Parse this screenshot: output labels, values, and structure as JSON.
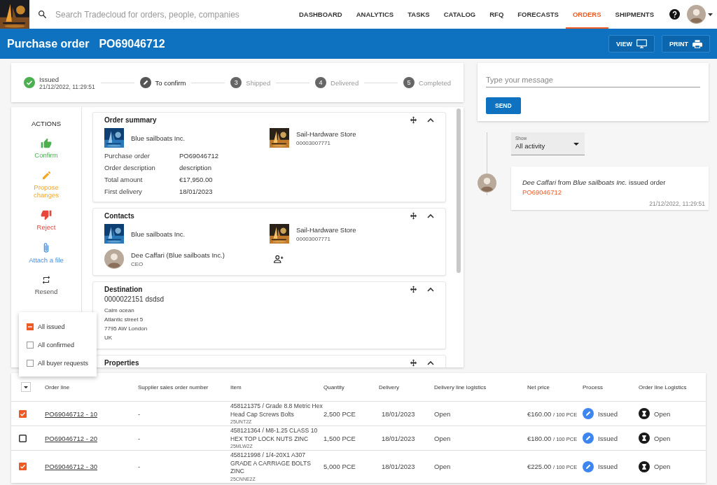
{
  "nav": {
    "search_placeholder": "Search Tradecloud for orders, people, companies",
    "items": [
      {
        "label": "DASHBOARD",
        "selected": false
      },
      {
        "label": "ANALYTICS",
        "selected": false
      },
      {
        "label": "TASKS",
        "selected": false
      },
      {
        "label": "CATALOG",
        "selected": false
      },
      {
        "label": "RFQ",
        "selected": false
      },
      {
        "label": "FORECASTS",
        "selected": false
      },
      {
        "label": "ORDERS",
        "selected": true
      },
      {
        "label": "SHIPMENTS",
        "selected": false
      }
    ]
  },
  "page_header": {
    "title": "Purchase order",
    "order_number": "PO69046712",
    "buttons": [
      {
        "label": "VIEW",
        "kind": "view"
      },
      {
        "label": "PRINT",
        "kind": "print"
      }
    ]
  },
  "stepper": [
    {
      "label": "Issued",
      "timestamp": "21/12/2022, 11:29:51",
      "done": true,
      "current": false
    },
    {
      "label": "To confirm",
      "done": false,
      "current": true
    },
    {
      "label": "Shipped",
      "number": "3",
      "done": false,
      "current": false
    },
    {
      "label": "Delivered",
      "number": "4",
      "done": false,
      "current": false
    },
    {
      "label": "Completed",
      "number": "5",
      "done": false,
      "current": false
    }
  ],
  "actions": {
    "title": "ACTIONS",
    "items": [
      {
        "label": "Confirm",
        "kind": "confirm"
      },
      {
        "label": "Propose changes",
        "kind": "propose"
      },
      {
        "label": "Reject",
        "kind": "reject"
      },
      {
        "label": "Attach a file",
        "kind": "attach"
      },
      {
        "label": "Resend",
        "kind": "resend"
      }
    ]
  },
  "sections": [
    {
      "kind": "summary",
      "title": "Order summary",
      "buyer": {
        "name": "Blue sailboats Inc."
      },
      "supplier": {
        "name": "Sail-Hardware Store",
        "number": "00003007771"
      },
      "fields": [
        {
          "label": "Purchase order",
          "value": "PO69046712"
        },
        {
          "label": "Order description",
          "value": "description"
        },
        {
          "label": "Total amount",
          "value": "€17,950.00"
        },
        {
          "label": "First delivery",
          "value": "18/01/2023"
        }
      ]
    },
    {
      "kind": "contacts",
      "title": "Contacts",
      "buyer": {
        "name": "Blue sailboats Inc."
      },
      "supplier": {
        "name": "Sail-Hardware Store",
        "number": "00003007771"
      },
      "person": {
        "name": "Dee Caffari (Blue sailboats Inc.)",
        "role": "CEO"
      }
    },
    {
      "kind": "address",
      "title": "Destination",
      "heading": "0000022151 dsdsd",
      "lines": [
        "Calm ocean",
        "Atlantic street 5",
        "7795 AW London",
        "UK"
      ]
    },
    {
      "kind": "empty",
      "title": "Properties"
    }
  ],
  "filter_menu": [
    {
      "label": "All issued",
      "indeterminate": true
    },
    {
      "label": "All confirmed",
      "indeterminate": false
    },
    {
      "label": "All buyer requests",
      "indeterminate": false
    }
  ],
  "message": {
    "placeholder": "Type your message",
    "send": "SEND"
  },
  "activity": {
    "filter_label": "Show",
    "filter_value": "All activity",
    "entries": [
      {
        "text": "*Dee Caffari* from *Blue sailboats Inc.* issued order",
        "link": "PO69046712",
        "time": "21/12/2022, 11:29:51"
      }
    ]
  },
  "table": {
    "columns": [
      "Order line",
      "Supplier sales order number",
      "Item",
      "Quantity",
      "Delivery",
      "Delivery line logistics",
      "Net price",
      "Process",
      "Order line Logistics"
    ],
    "rows": [
      {
        "checked": true,
        "order_line": "PO69046712 - 10",
        "supplier_order": "-",
        "item": "458121375 / Grade 8.8 Metric Hex Head Cap Screws Bolts",
        "item_code": "25UNT2Z",
        "quantity": "2,500 PCE",
        "delivery": "18/01/2023",
        "delivery_logistics": "Open",
        "net_price": "€160.00",
        "price_unit": "/ 100 PCE",
        "process": "Issued",
        "logistics": "Open"
      },
      {
        "checked": false,
        "order_line": "PO69046712 - 20",
        "supplier_order": "-",
        "item": "458121364 / M8-1.25 CLASS 10 HEX TOP LOCK NUTS ZINC",
        "item_code": "25MLW2Z",
        "quantity": "1,500 PCE",
        "delivery": "18/01/2023",
        "delivery_logistics": "Open",
        "net_price": "€180.00",
        "price_unit": "/ 100 PCE",
        "process": "Issued",
        "logistics": "Open"
      },
      {
        "checked": true,
        "order_line": "PO69046712 - 30",
        "supplier_order": "-",
        "item": "458121998 / 1/4-20X1 A307 GRADE A CARRIAGE BOLTS ZINC",
        "item_code": "25CNNE2Z",
        "quantity": "5,000 PCE",
        "delivery": "18/01/2023",
        "delivery_logistics": "Open",
        "net_price": "€225.00",
        "price_unit": "/ 100 PCE",
        "process": "Issued",
        "logistics": "Open"
      }
    ]
  }
}
